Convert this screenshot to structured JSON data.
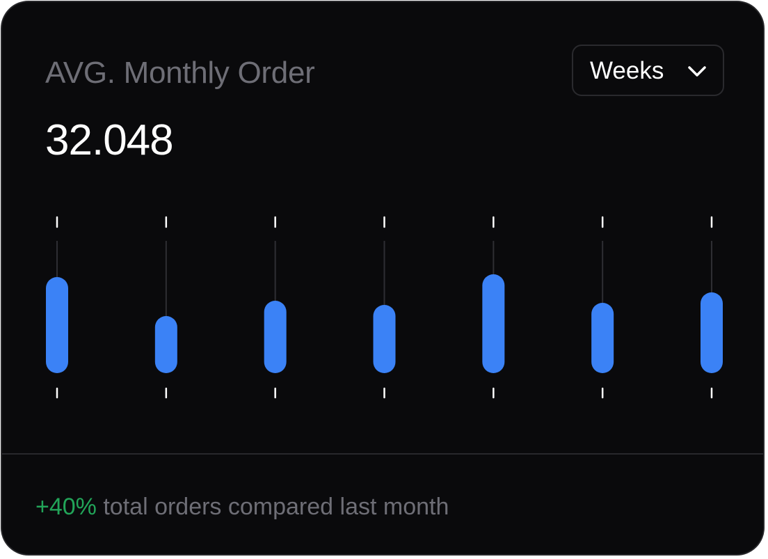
{
  "card": {
    "title": "AVG. Monthly Order",
    "value": "32.048",
    "period_selector": {
      "selected": "Weeks",
      "icon": "chevron-down-icon"
    },
    "footer": {
      "change": "+40%",
      "text": " total orders compared last month"
    }
  },
  "colors": {
    "background": "#0a0a0c",
    "bar": "#3b82f6",
    "positive": "#22a559",
    "muted_text": "#6e6e76"
  },
  "chart_data": {
    "type": "bar",
    "categories": [
      "",
      "",
      "",
      "",
      "",
      "",
      ""
    ],
    "values": [
      138,
      82,
      104,
      98,
      142,
      101,
      116
    ],
    "ylim": [
      0,
      190
    ],
    "grid": false
  }
}
